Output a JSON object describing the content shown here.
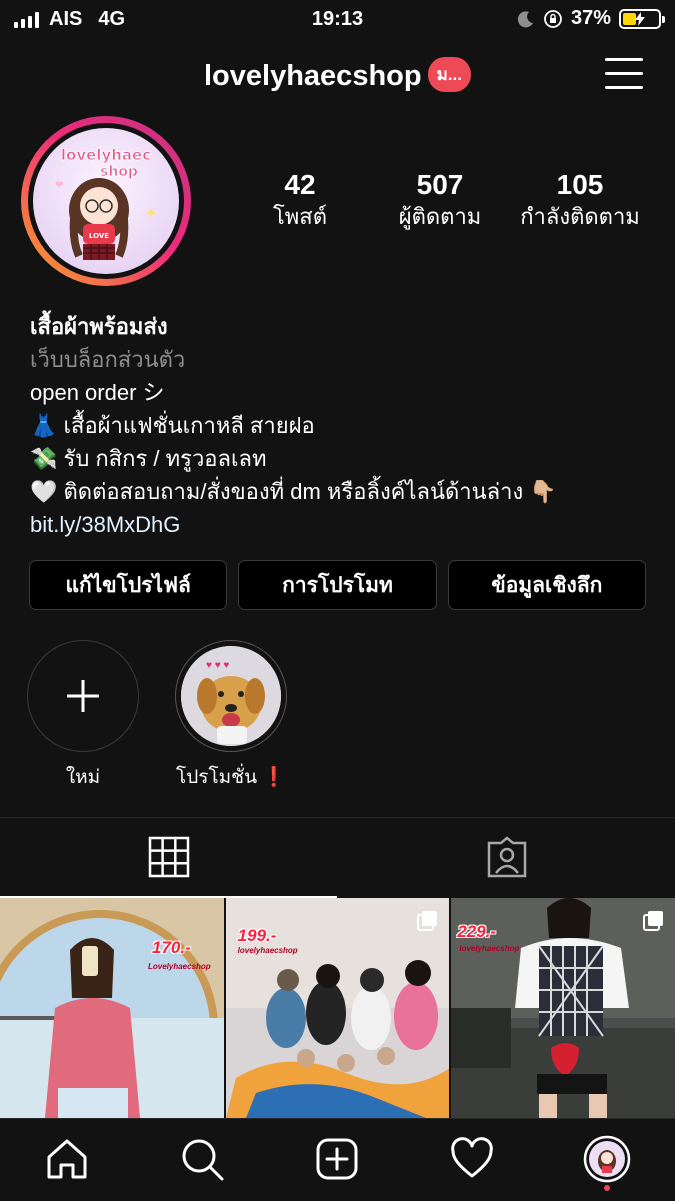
{
  "status_bar": {
    "carrier": "AIS",
    "network": "4G",
    "time": "19:13",
    "battery": "37%"
  },
  "header": {
    "username": "lovelyhaecshop",
    "badge": "ม..."
  },
  "stats": [
    {
      "value": "42",
      "label": "โพสต์"
    },
    {
      "value": "507",
      "label": "ผู้ติดตาม"
    },
    {
      "value": "105",
      "label": "กำลังติดตาม"
    }
  ],
  "bio": {
    "name": "เสื้อผ้าพร้อมส่ง",
    "category": "เว็บบล็อกส่วนตัว",
    "line1": "open order シ",
    "line2": "👗 เสื้อผ้าแฟชั่นเกาหลี สายฝอ",
    "line3": "💸 รับ กสิกร / ทรูวอลเลท",
    "line4": "🤍 ติดต่อสอบถาม/สั่งของที่ dm หรือลิ้งค์ไลน์ด้านล่าง 👇🏼",
    "link": "bit.ly/38MxDhG"
  },
  "buttons": {
    "edit_profile": "แก้ไขโปรไฟล์",
    "promote": "การโปรโมท",
    "insights": "ข้อมูลเชิงลึก"
  },
  "highlights": [
    {
      "label": "ใหม่"
    },
    {
      "label": "โปรโมชั่น ❗"
    }
  ],
  "logo_text": {
    "line1": "lovelyhaec",
    "line2": "shop",
    "shirt": "LOVE"
  },
  "posts": [
    {
      "price": "170.-",
      "shop": "Lovelyhaecshop"
    },
    {
      "price": "199.-",
      "shop": "lovelyhaecshop"
    },
    {
      "price": "229.-",
      "shop": "lovelyhaecshop"
    }
  ],
  "colors": {
    "background": "#121212",
    "badge": "#ed4956",
    "price": "#ff1e3c",
    "ring_start": "#f9a826",
    "ring_end": "#c13584"
  },
  "icons": [
    "signal-icon",
    "moon-icon",
    "rotation-lock-icon",
    "battery-icon",
    "menu-icon",
    "plus-icon",
    "grid-icon",
    "tagged-icon",
    "home-icon",
    "search-icon",
    "add-post-icon",
    "heart-icon",
    "profile-icon"
  ]
}
